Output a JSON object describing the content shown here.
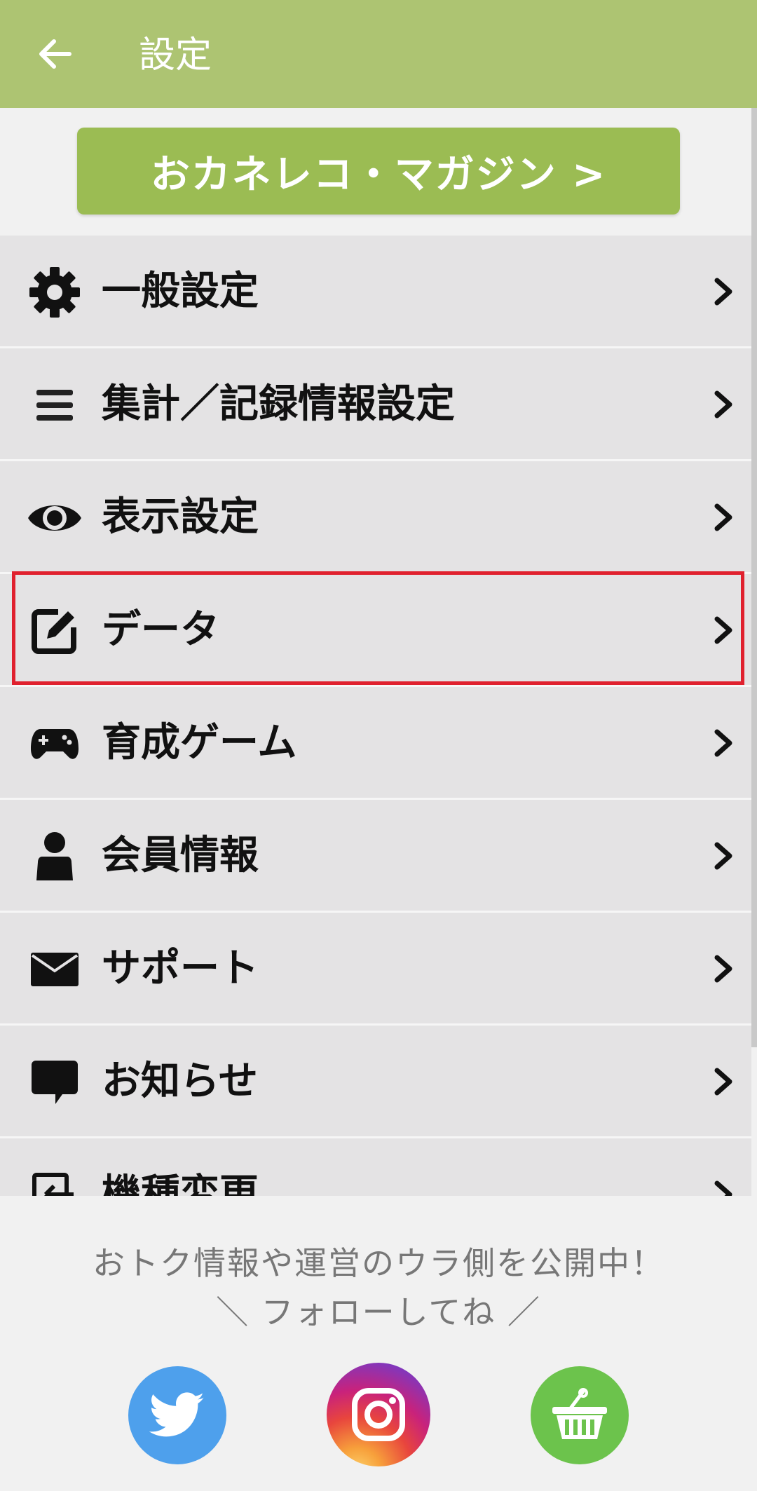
{
  "app_bar": {
    "title": "設定",
    "back_icon": "arrow-left-icon"
  },
  "magazine_button": {
    "label": "おカネレコ・マガジン >"
  },
  "menu": {
    "items": [
      {
        "label": "一般設定",
        "icon": "gear-icon"
      },
      {
        "label": "集計／記録情報設定",
        "icon": "list-icon"
      },
      {
        "label": "表示設定",
        "icon": "eye-icon"
      },
      {
        "label": "データ",
        "icon": "edit-icon"
      },
      {
        "label": "育成ゲーム",
        "icon": "gamepad-icon"
      },
      {
        "label": "会員情報",
        "icon": "person-icon"
      },
      {
        "label": "サポート",
        "icon": "mail-icon"
      },
      {
        "label": "お知らせ",
        "icon": "chat-bubble-icon"
      },
      {
        "label": "機種変更",
        "icon": "device-transfer-icon"
      }
    ],
    "chevron_icon": "chevron-right-icon",
    "highlighted_item": "データ"
  },
  "footer": {
    "line1": "おトク情報や運営のウラ側を公開中！",
    "line2": "＼ フォローしてね ／",
    "social": [
      "twitter-icon",
      "instagram-icon",
      "shop-basket-icon"
    ]
  },
  "colors": {
    "app_bar": "#adc472",
    "magazine_button": "#9bbc53",
    "menu_bg": "#e4e3e4",
    "highlight": "#e0212e",
    "twitter": "#4ea0ec",
    "shop": "#6cc34c"
  }
}
